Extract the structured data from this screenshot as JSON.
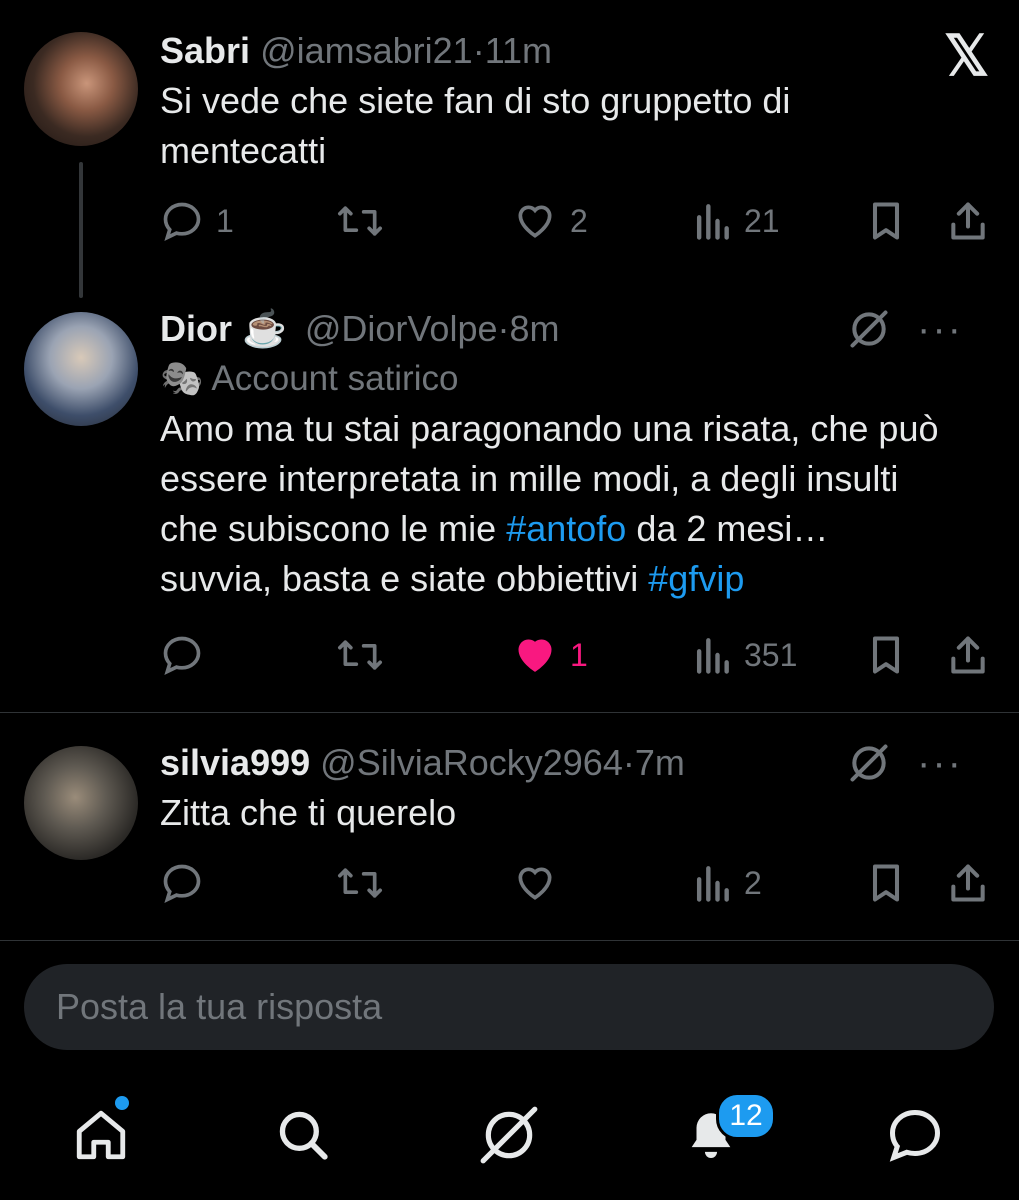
{
  "tweets": [
    {
      "name": "Sabri",
      "handle": "@iamsabri21",
      "separator": "·",
      "time": "11m",
      "label": "",
      "text": "Si vede che siete fan di sto gruppetto di mentecatti",
      "replies": "1",
      "retweets": "",
      "likes": "2",
      "views": "21"
    },
    {
      "name": "Dior ☕",
      "handle": "@DiorVolpe",
      "separator": "·",
      "time": "8m",
      "label": "Account satirico",
      "label_icon": "🎭",
      "text_parts": [
        "Amo ma tu stai paragonando una risata, che può essere interpretata in mille modi, a degli insulti che subiscono le mie ",
        "#antofo",
        " da 2 mesi… suvvia, basta e siate obbiettivi ",
        "#gfvip"
      ],
      "replies": "",
      "retweets": "",
      "likes": "1",
      "views": "351"
    },
    {
      "name": "silvia999",
      "handle": "@SilviaRocky2964",
      "separator": "·",
      "time": "7m",
      "label": "",
      "text": "Zitta che ti querelo",
      "replies": "",
      "retweets": "",
      "likes": "",
      "views": "2"
    }
  ],
  "reply_box": {
    "placeholder": "Posta la tua risposta"
  },
  "bottom_nav": {
    "items": [
      "home-icon",
      "search-icon",
      "grok-icon",
      "notifications-icon",
      "messages-icon"
    ],
    "notification_count": "12"
  },
  "colors": {
    "accent": "#1d9bf0",
    "like": "#f91880",
    "muted": "#71767b",
    "background": "#000000"
  }
}
